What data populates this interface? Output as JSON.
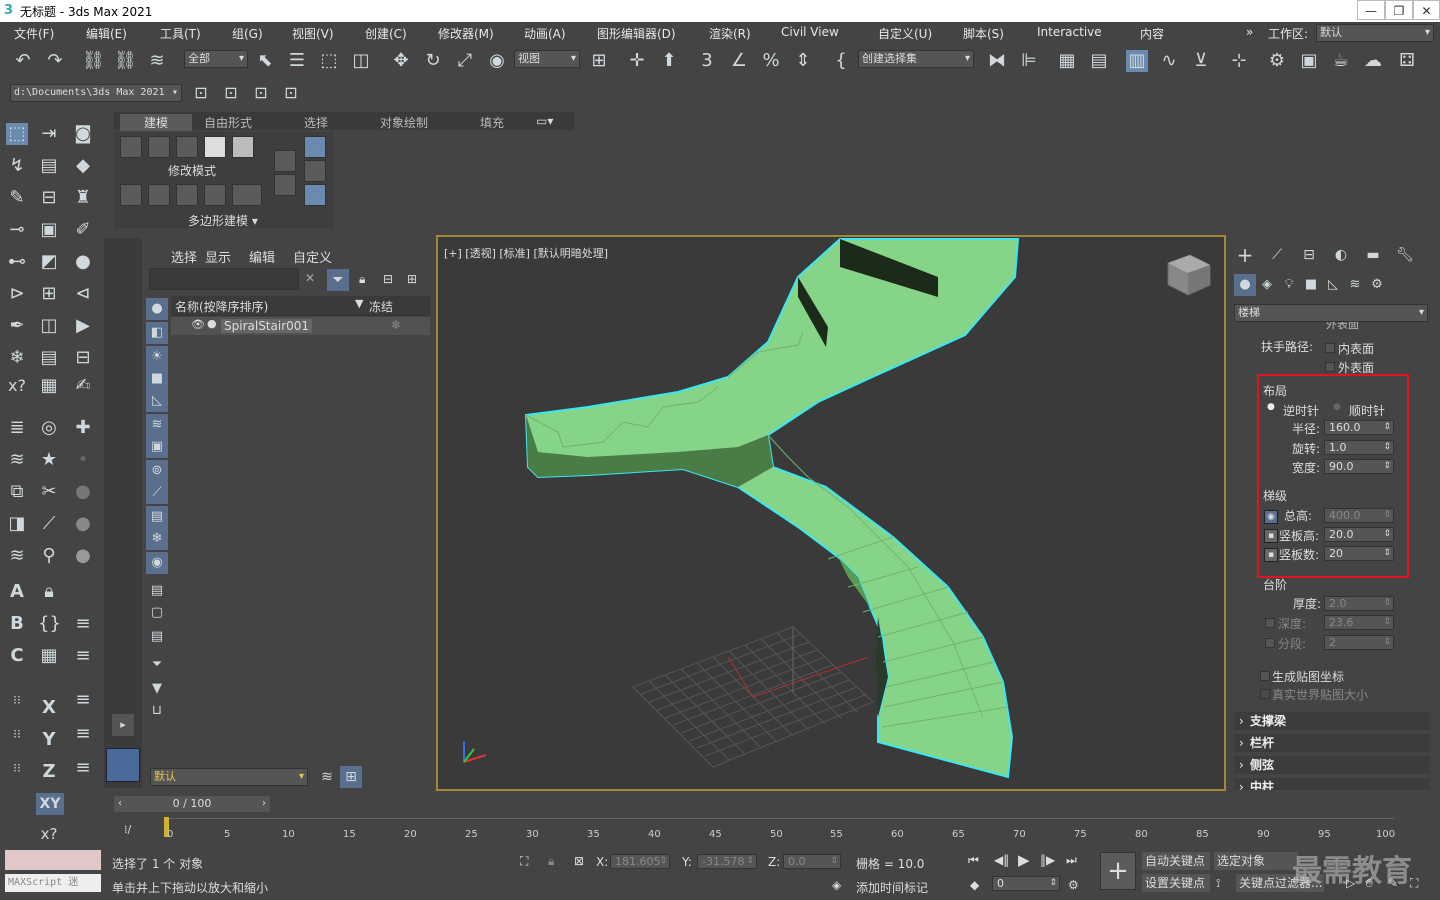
{
  "title_bar": {
    "app_icon": "3ds-max-icon",
    "title": "无标题 - 3ds Max 2021",
    "minimize": "—",
    "maximize": "❐",
    "close": "✕"
  },
  "menu": [
    "文件(F)",
    "编辑(E)",
    "工具(T)",
    "组(G)",
    "视图(V)",
    "创建(C)",
    "修改器(M)",
    "动画(A)",
    "图形编辑器(D)",
    "渲染(R)",
    "Civil View",
    "自定义(U)",
    "脚本(S)",
    "Interactive",
    "内容"
  ],
  "workspace": {
    "label": "工作区:",
    "value": "默认"
  },
  "toolbar": {
    "selection_filter": "全部",
    "ref_coord": "视图",
    "named_selection": "创建选择集"
  },
  "path_bar": {
    "path": "d:\\Documents\\3ds Max 2021"
  },
  "ribbon": {
    "tabs": [
      "建模",
      "自由形式",
      "选择",
      "对象绘制",
      "填充"
    ],
    "modify_mode": "修改模式",
    "polygon_modeling": "多边形建模 ▾"
  },
  "scene_explorer": {
    "tabs": [
      "选择",
      "显示",
      "编辑",
      "自定义"
    ],
    "col_name": "名称(按降序排序)",
    "col_freeze": "冻结",
    "objects": [
      {
        "name": "SpiralStair001"
      }
    ],
    "layer": "默认"
  },
  "viewport": {
    "label": "[+] [透视] [标准] [默认明暗处理]"
  },
  "command_panel": {
    "category": "楼梯",
    "handrail_path": "扶手路径:",
    "handrail_opts": [
      "外表面",
      "内表面",
      "外表面"
    ],
    "layout": {
      "title": "布局",
      "ccw": "逆时针",
      "cw": "顺时针",
      "radius_label": "半径:",
      "radius": "160.0",
      "revs_label": "旋转:",
      "revs": "1.0",
      "width_label": "宽度:",
      "width": "90.0"
    },
    "steps": {
      "title": "梯级",
      "overall_label": "总高:",
      "overall": "400.0",
      "riser_ht_label": "竖板高:",
      "riser_ht": "20.0",
      "riser_ct_label": "竖板数:",
      "riser_ct": "20"
    },
    "stairs": {
      "title": "台阶",
      "thickness_label": "厚度:",
      "thickness": "2.0",
      "depth_label": "深度:",
      "depth": "23.6",
      "segments_label": "分段:",
      "segments": "2"
    },
    "gen_map": "生成贴图坐标",
    "real_world": "真实世界贴图大小",
    "rollouts": [
      "支撑梁",
      "栏杆",
      "侧弦",
      "中柱"
    ]
  },
  "timeline": {
    "frame": "0 / 100",
    "ticks": [
      "0",
      "5",
      "10",
      "15",
      "20",
      "25",
      "30",
      "35",
      "40",
      "45",
      "50",
      "55",
      "60",
      "65",
      "70",
      "75",
      "80",
      "85",
      "90",
      "95",
      "100"
    ]
  },
  "status": {
    "maxscript": "MAXScript 迷",
    "selected": "选择了 1 个 对象",
    "hint": "单击并上下拖动以放大和缩小",
    "x_label": "X:",
    "x": "181.605",
    "y_label": "Y:",
    "y": "-31.578",
    "z_label": "Z:",
    "z": "0.0",
    "grid": "栅格 = 10.0",
    "add_time_tag": "添加时间标记",
    "auto_key": "自动关键点",
    "selected_obj": "选定对象",
    "set_key": "设置关键点",
    "key_filters": "关键点过滤器...",
    "frame_field": "0",
    "watermark": "最需教育"
  }
}
